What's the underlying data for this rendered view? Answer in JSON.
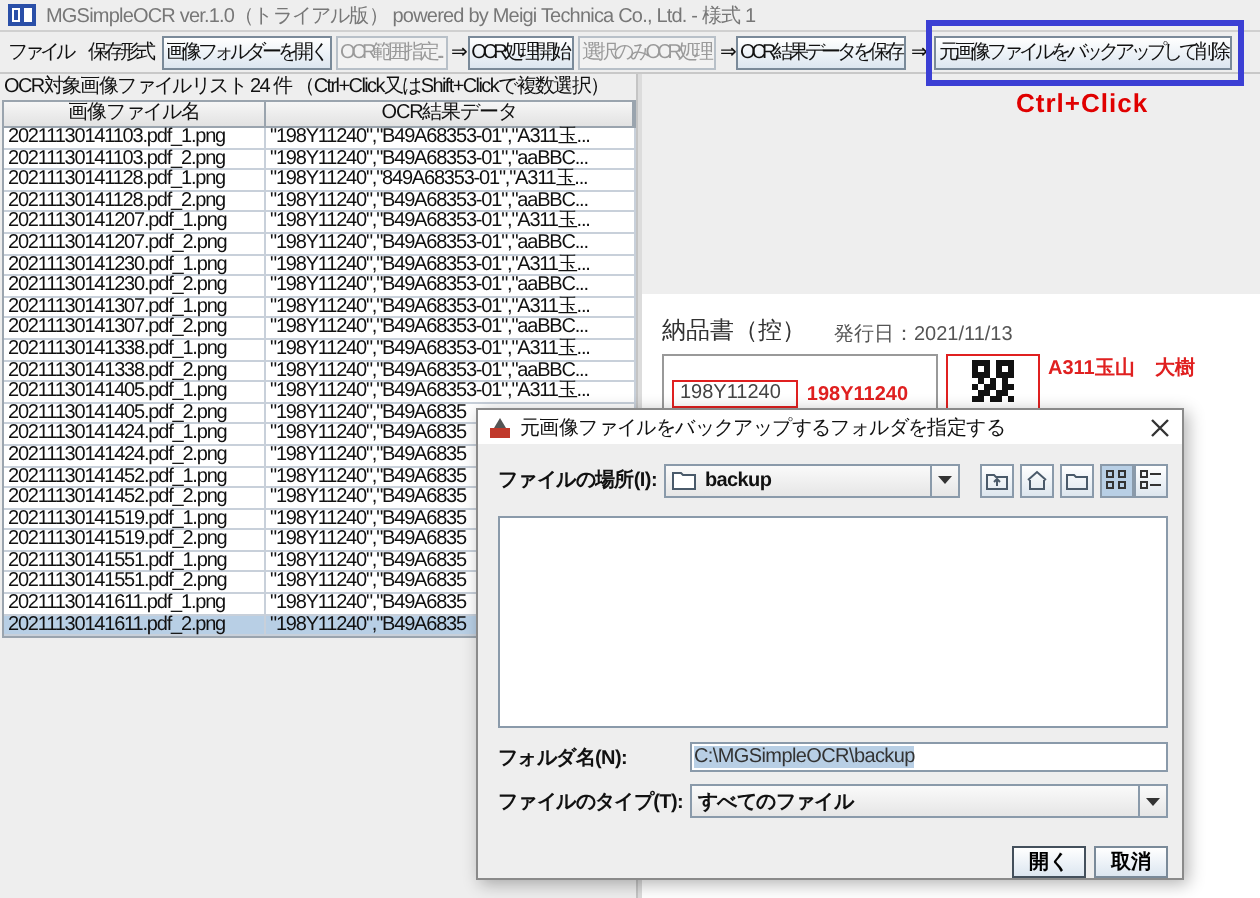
{
  "window": {
    "title": "MGSimpleOCR ver.1.0（トライアル版） powered by Meigi Technica Co., Ltd. - 様式 1"
  },
  "menu": [
    "ファイル",
    "保存形式"
  ],
  "toolbar": [
    {
      "kind": "button",
      "label": "画像フォルダーを開く",
      "disabled": false,
      "highlighted": false
    },
    {
      "kind": "button",
      "label": "OCR範囲指定...",
      "disabled": true,
      "highlighted": false
    },
    {
      "kind": "arrow",
      "label": "⇒"
    },
    {
      "kind": "button",
      "label": "OCR処理開始",
      "disabled": false,
      "highlighted": false
    },
    {
      "kind": "button",
      "label": "選択のみOCR処理",
      "disabled": true,
      "highlighted": false
    },
    {
      "kind": "arrow",
      "label": "⇒"
    },
    {
      "kind": "button",
      "label": "OCR結果データを保存",
      "disabled": false,
      "highlighted": false
    },
    {
      "kind": "arrow",
      "label": "⇒"
    },
    {
      "kind": "button",
      "label": "元画像ファイルをバックアップして削除",
      "disabled": false,
      "highlighted": true
    }
  ],
  "annotation": {
    "text": "Ctrl+Click"
  },
  "file_list": {
    "caption": "OCR対象画像ファイルリスト 24 件 （Ctrl+Click又はShift+Clickで複数選択）",
    "columns": [
      "画像ファイル名",
      "OCR結果データ"
    ],
    "rows": [
      {
        "cells": [
          "20211130141103.pdf_1.png",
          "\"198Y11240\",\"B49A68353-01\",\"A311玉..."
        ],
        "selected": false
      },
      {
        "cells": [
          "20211130141103.pdf_2.png",
          "\"198Y11240\",\"B49A68353-01\",\"aaBBC..."
        ],
        "selected": false
      },
      {
        "cells": [
          "20211130141128.pdf_1.png",
          "\"198Y11240\",\"849A68353-01\",\"A311玉..."
        ],
        "selected": false
      },
      {
        "cells": [
          "20211130141128.pdf_2.png",
          "\"198Y11240\",\"B49A68353-01\",\"aaBBC..."
        ],
        "selected": false
      },
      {
        "cells": [
          "20211130141207.pdf_1.png",
          "\"198Y11240\",\"B49A68353-01\",\"A311玉..."
        ],
        "selected": false
      },
      {
        "cells": [
          "20211130141207.pdf_2.png",
          "\"198Y11240\",\"B49A68353-01\",\"aaBBC..."
        ],
        "selected": false
      },
      {
        "cells": [
          "20211130141230.pdf_1.png",
          "\"198Y11240\",\"B49A68353-01\",\"A311玉..."
        ],
        "selected": false
      },
      {
        "cells": [
          "20211130141230.pdf_2.png",
          "\"198Y11240\",\"B49A68353-01\",\"aaBBC..."
        ],
        "selected": false
      },
      {
        "cells": [
          "20211130141307.pdf_1.png",
          "\"198Y11240\",\"B49A68353-01\",\"A311玉..."
        ],
        "selected": false
      },
      {
        "cells": [
          "20211130141307.pdf_2.png",
          "\"198Y11240\",\"B49A68353-01\",\"aaBBC..."
        ],
        "selected": false
      },
      {
        "cells": [
          "20211130141338.pdf_1.png",
          "\"198Y11240\",\"B49A68353-01\",\"A311玉..."
        ],
        "selected": false
      },
      {
        "cells": [
          "20211130141338.pdf_2.png",
          "\"198Y11240\",\"B49A68353-01\",\"aaBBC..."
        ],
        "selected": false
      },
      {
        "cells": [
          "20211130141405.pdf_1.png",
          "\"198Y11240\",\"B49A68353-01\",\"A311玉..."
        ],
        "selected": false
      },
      {
        "cells": [
          "20211130141405.pdf_2.png",
          "\"198Y11240\",\"B49A6835"
        ],
        "selected": false
      },
      {
        "cells": [
          "20211130141424.pdf_1.png",
          "\"198Y11240\",\"B49A6835"
        ],
        "selected": false
      },
      {
        "cells": [
          "20211130141424.pdf_2.png",
          "\"198Y11240\",\"B49A6835"
        ],
        "selected": false
      },
      {
        "cells": [
          "20211130141452.pdf_1.png",
          "\"198Y11240\",\"B49A6835"
        ],
        "selected": false
      },
      {
        "cells": [
          "20211130141452.pdf_2.png",
          "\"198Y11240\",\"B49A6835"
        ],
        "selected": false
      },
      {
        "cells": [
          "20211130141519.pdf_1.png",
          "\"198Y11240\",\"B49A6835"
        ],
        "selected": false
      },
      {
        "cells": [
          "20211130141519.pdf_2.png",
          "\"198Y11240\",\"B49A6835"
        ],
        "selected": false
      },
      {
        "cells": [
          "20211130141551.pdf_1.png",
          "\"198Y11240\",\"B49A6835"
        ],
        "selected": false
      },
      {
        "cells": [
          "20211130141551.pdf_2.png",
          "\"198Y11240\",\"B49A6835"
        ],
        "selected": false
      },
      {
        "cells": [
          "20211130141611.pdf_1.png",
          "\"198Y11240\",\"B49A6835"
        ],
        "selected": false
      },
      {
        "cells": [
          "20211130141611.pdf_2.png",
          "\"198Y11240\",\"B49A6835"
        ],
        "selected": true
      }
    ]
  },
  "preview": {
    "document": {
      "title": "納品書（控）",
      "date": "発行日：2021/11/13",
      "code_field": "198Y11240",
      "code_result": "198Y11240",
      "name_result": "A311玉山　大樹"
    }
  },
  "dialog": {
    "title": "元画像ファイルをバックアップするフォルダを指定する",
    "location_label": "ファイルの場所(I):",
    "location": "backup",
    "view_buttons": [
      {
        "kind": "list",
        "selected": true
      },
      {
        "kind": "details",
        "selected": false
      }
    ],
    "folder_name_label": "フォルダ名(N):",
    "folder_name": "C:\\MGSimpleOCR\\backup",
    "file_type_label": "ファイルのタイプ(T):",
    "file_type": "すべてのファイル",
    "buttons": [
      "開く",
      "取消"
    ]
  }
}
